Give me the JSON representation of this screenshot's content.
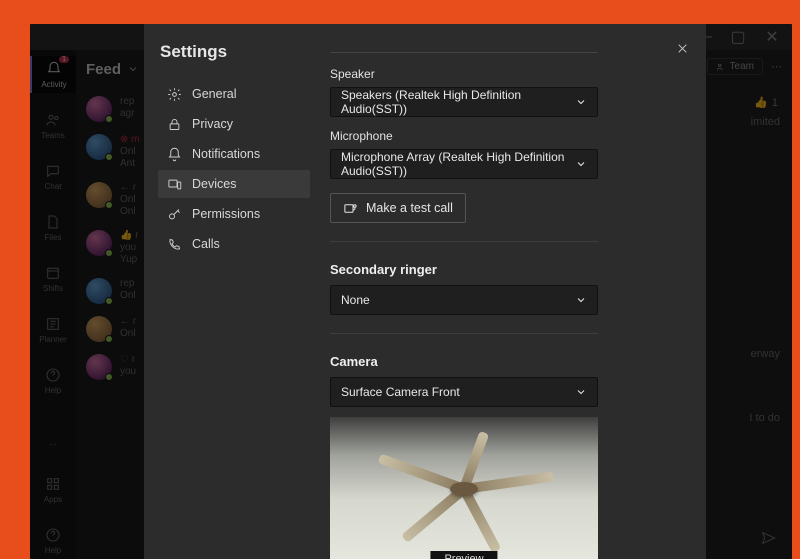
{
  "title_bar": {
    "min": "—",
    "max": "▢",
    "close": "✕"
  },
  "rail": {
    "items": [
      {
        "label": "Activity"
      },
      {
        "label": "Teams"
      },
      {
        "label": "Chat"
      },
      {
        "label": "Files"
      },
      {
        "label": "Shifts"
      },
      {
        "label": "Planner"
      },
      {
        "label": "Help"
      }
    ],
    "apps_label": "Apps",
    "help2_label": "Help"
  },
  "feed": {
    "header": "Feed",
    "items": [
      {
        "l1": "rep",
        "l2": "agr"
      },
      {
        "l1": "⊗ m",
        "l2": "Onl",
        "l3": "Ant"
      },
      {
        "l1": "← r",
        "l2": "Onl",
        "l3": "Onl"
      },
      {
        "l1": "👍 r",
        "l2": "you",
        "l3": "Yup"
      },
      {
        "l1": "rep",
        "l2": "Onl"
      },
      {
        "l1": "← r",
        "l2": "Onl"
      },
      {
        "l1": "♡ r",
        "l2": "you"
      }
    ]
  },
  "main": {
    "team_chip": "Team",
    "like_count": "1",
    "like_sub": "imited",
    "frag1": "erway",
    "frag2": "I to do"
  },
  "settings": {
    "title": "Settings",
    "nav": [
      {
        "label": "General"
      },
      {
        "label": "Privacy"
      },
      {
        "label": "Notifications"
      },
      {
        "label": "Devices"
      },
      {
        "label": "Permissions"
      },
      {
        "label": "Calls"
      }
    ],
    "speaker_label": "Speaker",
    "speaker_value": "Speakers (Realtek High Definition Audio(SST))",
    "mic_label": "Microphone",
    "mic_value": "Microphone Array (Realtek High Definition Audio(SST))",
    "test_call": "Make a test call",
    "secondary_head": "Secondary ringer",
    "secondary_value": "None",
    "camera_head": "Camera",
    "camera_value": "Surface Camera Front",
    "preview_label": "Preview"
  }
}
